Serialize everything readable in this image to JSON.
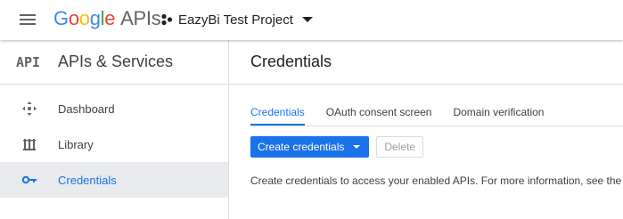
{
  "header": {
    "logo_letters": [
      "G",
      "o",
      "o",
      "g",
      "l",
      "e"
    ],
    "logo_product": "APIs",
    "project_name": "EazyBi Test Project"
  },
  "sidebar": {
    "api_mark": "API",
    "title": "APIs & Services",
    "items": [
      {
        "label": "Dashboard",
        "icon": "dashboard-icon",
        "active": false
      },
      {
        "label": "Library",
        "icon": "library-icon",
        "active": false
      },
      {
        "label": "Credentials",
        "icon": "key-icon",
        "active": true
      }
    ]
  },
  "main": {
    "title": "Credentials",
    "tabs": [
      {
        "label": "Credentials",
        "active": true
      },
      {
        "label": "OAuth consent screen",
        "active": false
      },
      {
        "label": "Domain verification",
        "active": false
      }
    ],
    "create_button": "Create credentials",
    "delete_button": "Delete",
    "help_text": "Create credentials to access your enabled APIs. For more information, see the a"
  },
  "colors": {
    "accent": "#1a73e8",
    "active_bg": "#e8eaed",
    "divider": "#dadce0"
  }
}
